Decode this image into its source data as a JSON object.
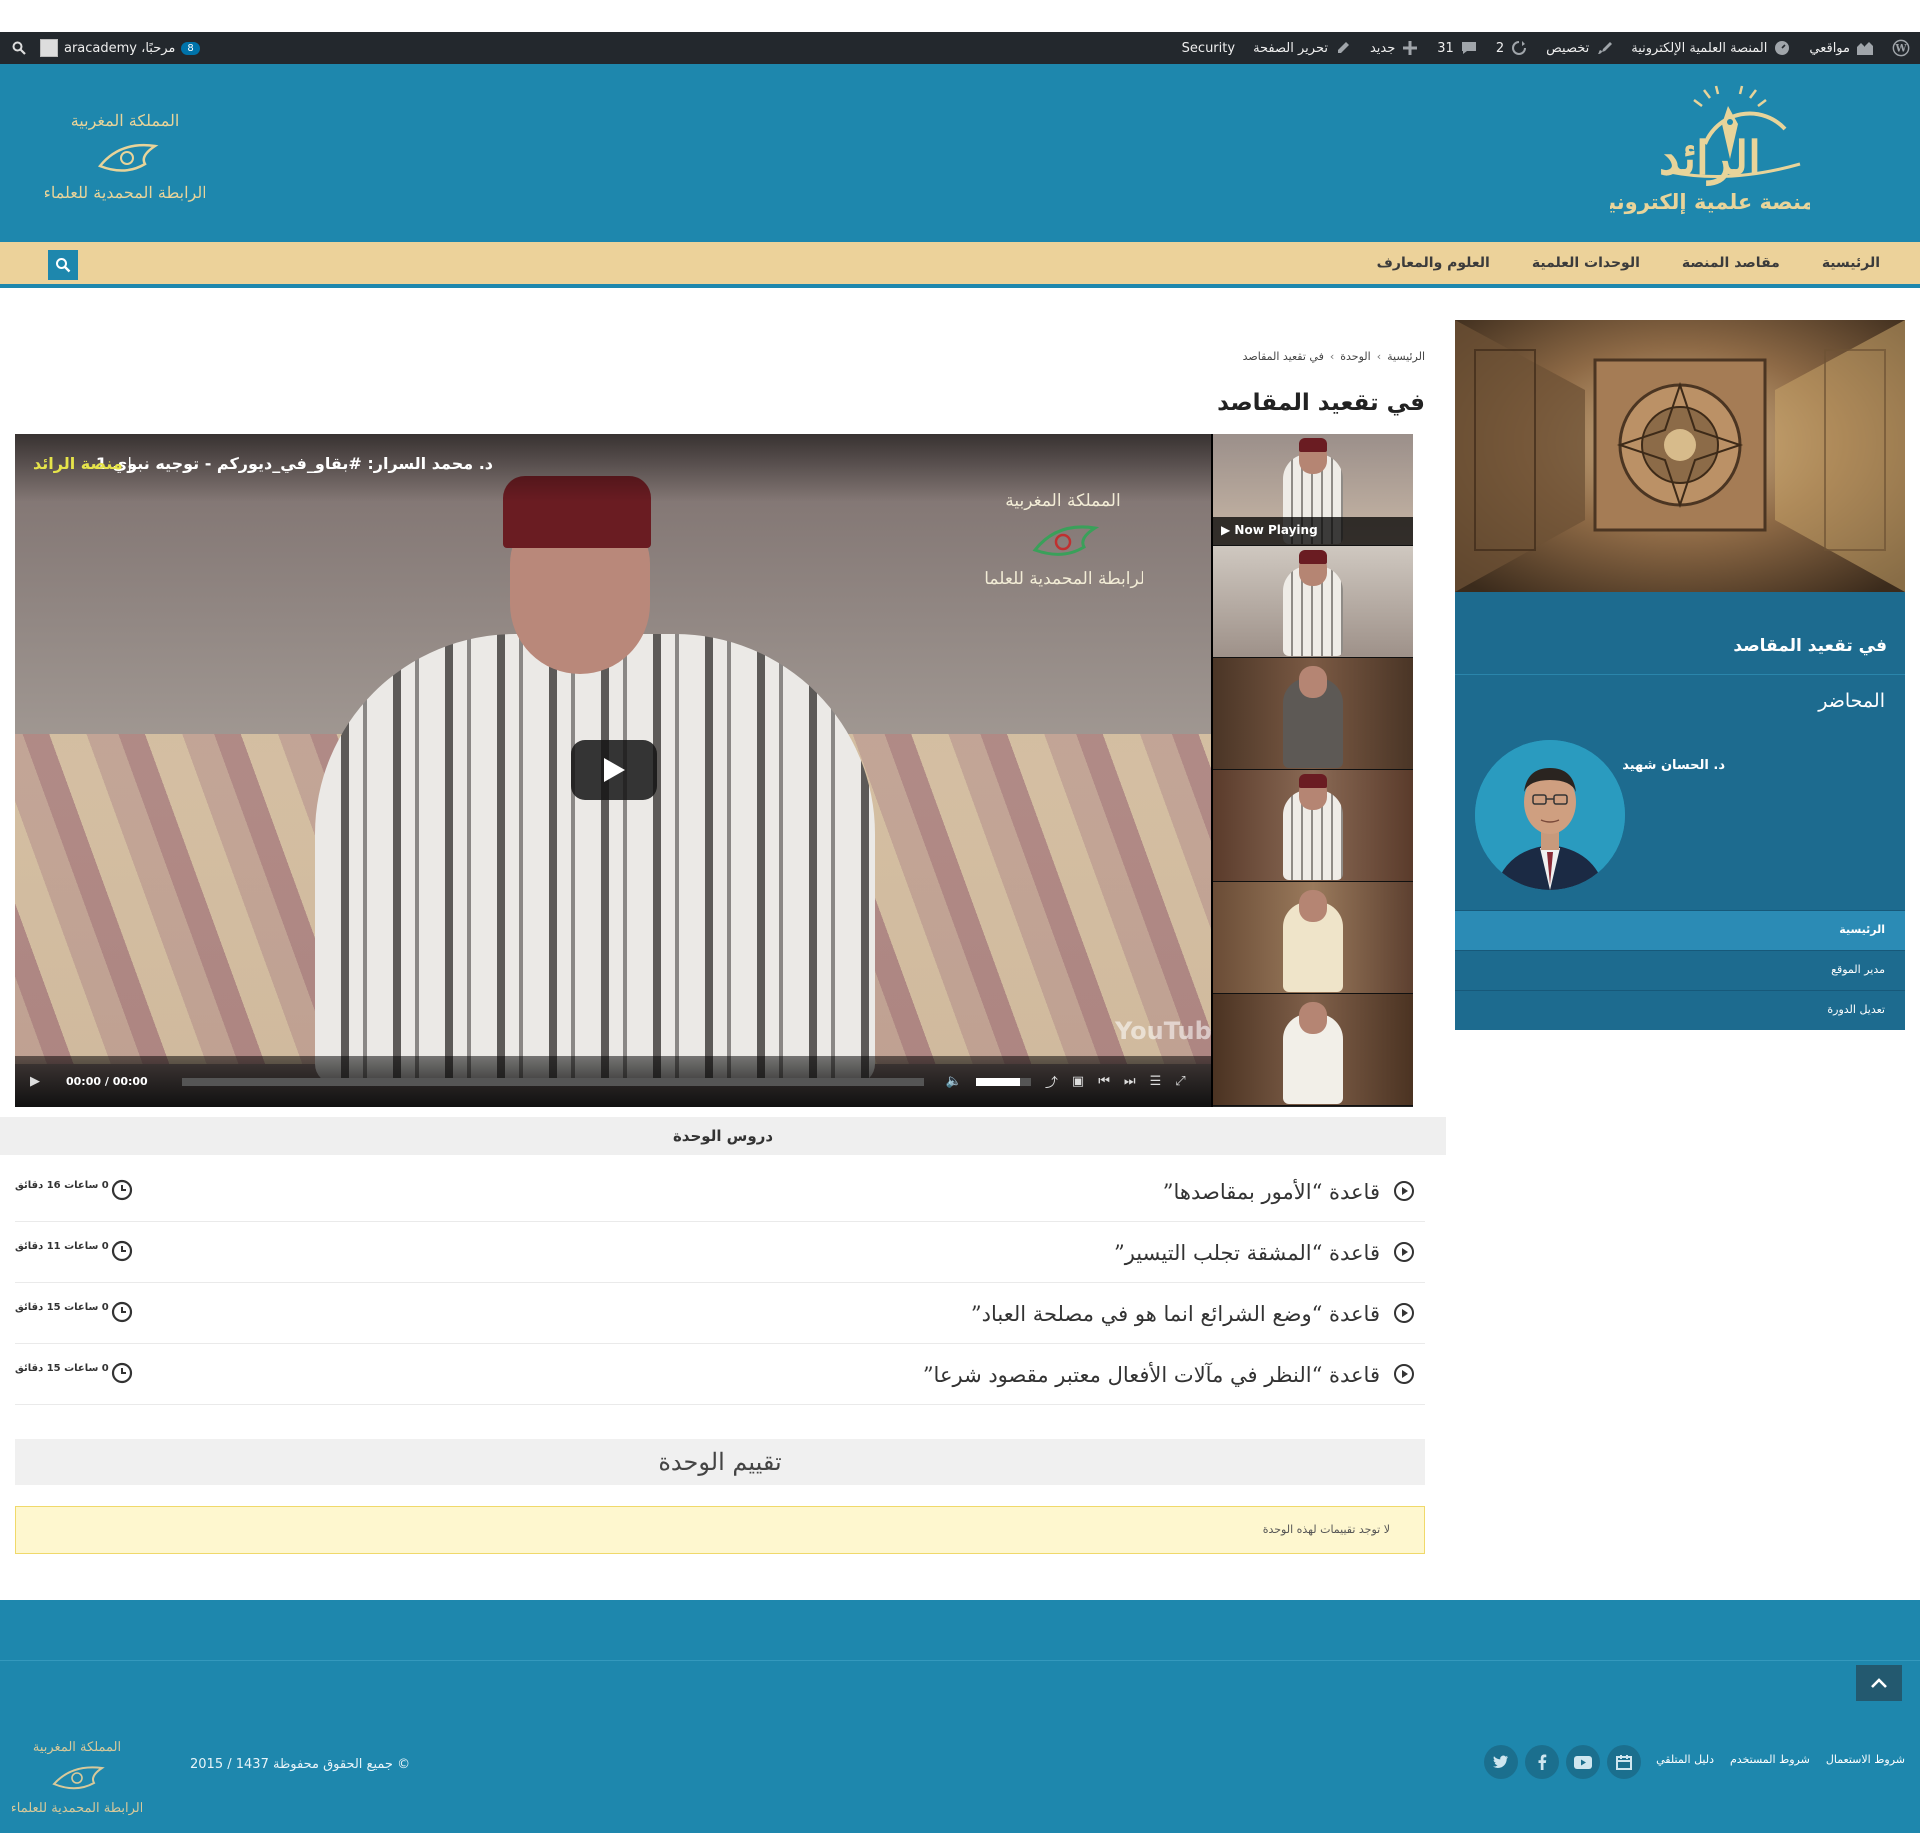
{
  "adminbar": {
    "sites": "مواقعي",
    "site_name": "المنصة العلمية الإلكترونية",
    "customize": "تخصيص",
    "updates": "2",
    "comments": "31",
    "new": "جديد",
    "edit_page": "تحرير الصفحة",
    "security": "Security",
    "greeting": "مرحبًا، aracademy",
    "notifications": "8"
  },
  "header": {
    "logo_title": "الرائد",
    "logo_subtitle": "منصة علمية إلكترونية",
    "league_line1": "المملكة المغربية",
    "league_line2": "الرابطة المحمدية للعلماء"
  },
  "nav": {
    "items": [
      "الرئيسية",
      "مقاصد المنصة",
      "الوحدات العلمية",
      "العلوم والمعارف"
    ]
  },
  "breadcrumb": {
    "home": "الرئيسية",
    "unit": "الوحدة",
    "current": "في تقعيد المقاصد"
  },
  "page_title": "في تقعيد المقاصد",
  "video": {
    "title": "د. محمد السرار: #بقاو_في_ديوركم - توجيه نبوي 1",
    "channel": "منصة الرائد",
    "youtube_mark": "YouTube",
    "time": "00:00 / 00:00",
    "progress": 0.0,
    "volume": 0.8,
    "now_playing": "Now Playing"
  },
  "lessons": {
    "header": "دروس الوحدة",
    "items": [
      {
        "title": "قاعدة “الأمور بمقاصدها”",
        "duration": "0 ساعات 16 دقائق"
      },
      {
        "title": "قاعدة “المشقة تجلب التيسير”",
        "duration": "0 ساعات 11 دقائق"
      },
      {
        "title": "قاعدة “وضع الشرائع انما هو في مصلحة العباد”",
        "duration": "0 ساعات 15 دقائق"
      },
      {
        "title": "قاعدة “النظر في مآلات الأفعال معتبر مقصود شرعا”",
        "duration": "0 ساعات 15 دقائق"
      }
    ]
  },
  "rating": {
    "header": "تقييم الوحدة",
    "message": "لا توجد تقييمات لهذه الوحدة"
  },
  "sidebar": {
    "title": "في تقعيد المقاصد",
    "instructor_label": "المحاضر",
    "instructor_name": "د. الحسان شهيد",
    "menu": [
      "الرئيسية",
      "مدير الموقع",
      "تعديل الدورة"
    ]
  },
  "footer": {
    "links": [
      "شروط الاستعمال",
      "شروط المستخدم",
      "دليل المتلقي"
    ],
    "copyright": "© جميع الحقوق محفوظة 1437 / 2015"
  },
  "colors": {
    "brand_blue": "#1e87ad",
    "nav_gold": "#ecd29a",
    "admin_bar": "#23282d",
    "sidebar_blue": "#1d6b8f"
  }
}
